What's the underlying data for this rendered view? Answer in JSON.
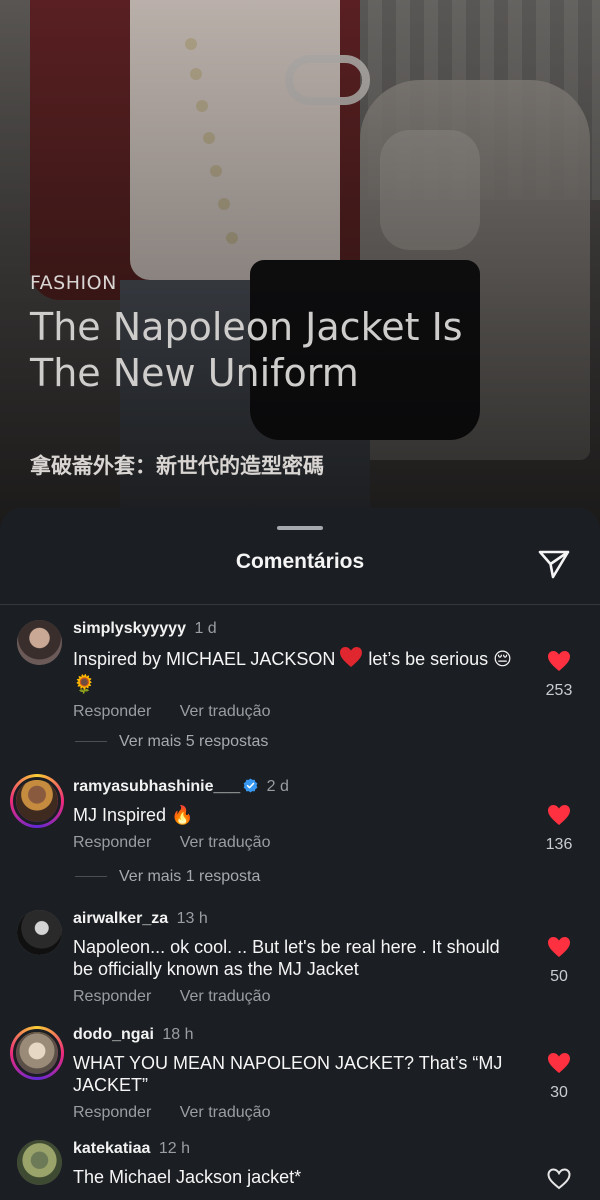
{
  "post": {
    "category": "FASHION",
    "title_line1": "The Napoleon Jacket Is",
    "title_line2": "The New Uniform",
    "subtitle": "拿破崙外套：新世代的造型密碼"
  },
  "sheet": {
    "title": "Comentários",
    "share_icon": "paper-plane-icon"
  },
  "comments": [
    {
      "username": "simplyskyyyyy",
      "time": "1 d",
      "text_part1": "Inspired by MICHAEL JACKSON",
      "heart_emoji": "❤️",
      "text_part2": " let’s be serious",
      "emojis_end": "😔 🌻",
      "reply": "Responder",
      "translate": "Ver tradução",
      "likes": "253",
      "liked": true,
      "more_replies": "Ver mais 5 respostas"
    },
    {
      "username": "ramyasubhashinie___",
      "verified": true,
      "time": "2 d",
      "text": "MJ Inspired",
      "emoji": "🔥",
      "reply": "Responder",
      "translate": "Ver tradução",
      "likes": "136",
      "liked": true,
      "more_replies": "Ver mais 1 resposta"
    },
    {
      "username": "airwalker_za",
      "time": "13 h",
      "text": "Napoleon... ok cool. .. But let's be real here .  It should be officially known as the MJ Jacket",
      "reply": "Responder",
      "translate": "Ver tradução",
      "likes": "50",
      "liked": true
    },
    {
      "username": "dodo_ngai",
      "time": "18 h",
      "text": "WHAT YOU MEAN NAPOLEON JACKET? That’s “MJ JACKET”",
      "reply": "Responder",
      "translate": "Ver tradução",
      "likes": "30",
      "liked": true
    },
    {
      "username": "katekatiaa",
      "time": "12 h",
      "text": "The Michael Jackson jacket*",
      "liked": false
    }
  ],
  "colors": {
    "sheet_bg": "#1b1e22",
    "like_red": "#ff3040",
    "muted_text": "#9a9ea4",
    "verified_blue": "#3897f0"
  }
}
